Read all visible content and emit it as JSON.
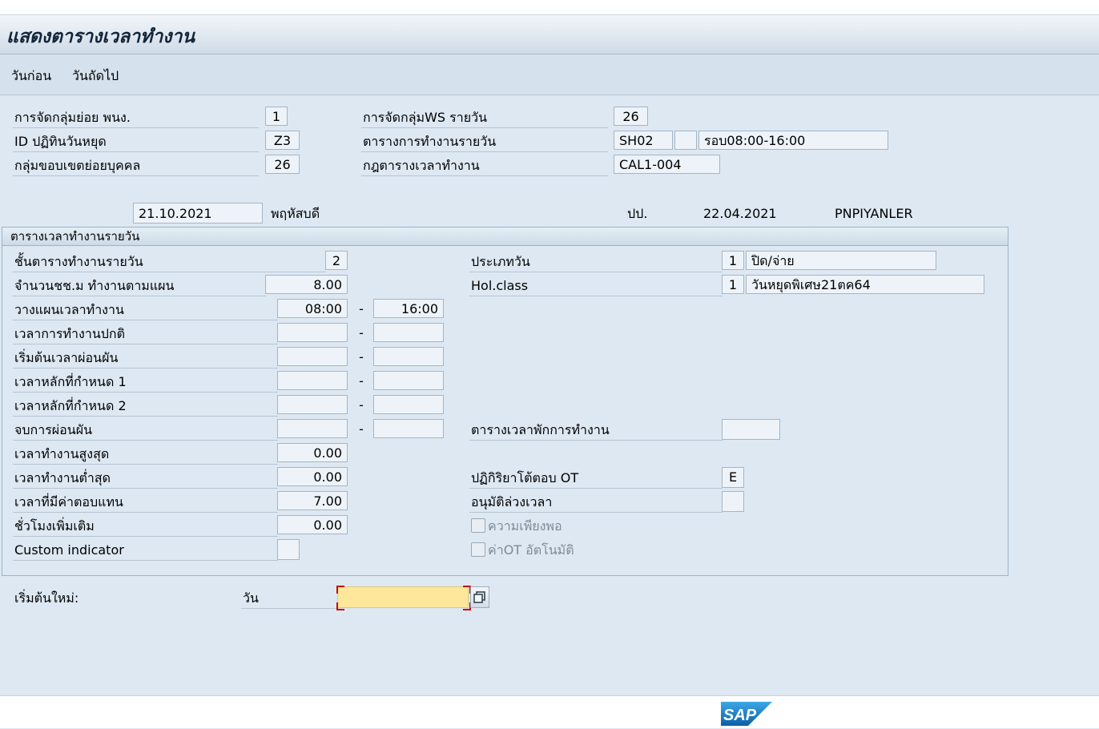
{
  "window": {
    "title": "แสดงตารางเวลาทำงาน"
  },
  "toolbar": {
    "prev_day": "วันก่อน",
    "next_day": "วันถัดไป"
  },
  "header": {
    "ee_subgroup_label": "การจัดกลุ่มย่อย พนง.",
    "ee_subgroup_value": "1",
    "holiday_cal_label": "ID ปฏิทินวันหยุด",
    "holiday_cal_value": "Z3",
    "ps_subarea_label": "กลุ่มขอบเขตย่อยบุคคล",
    "ps_subarea_value": "26",
    "ws_grouping_label": "การจัดกลุ่มWS รายวัน",
    "ws_grouping_value": "26",
    "daily_ws_label": "ตารางการทำงานรายวัน",
    "daily_ws_value": "SH02",
    "daily_ws_variant": "",
    "daily_ws_text": "รอบ08:00-16:00",
    "ws_rule_label": "กฎตารางเวลาทำงาน",
    "ws_rule_value": "CAL1-004"
  },
  "daterow": {
    "date": "21.10.2021",
    "weekday": "พฤหัสบดี",
    "changed_label": "ปป.",
    "changed_date": "22.04.2021",
    "changed_by": "PNPIYANLER"
  },
  "group": {
    "title": "ตารางเวลาทำงานรายวัน",
    "ws_class_label": "ชั้นตารางทำงานรายวัน",
    "ws_class_value": "2",
    "planned_hours_label": "จำนวนชช.ม ทำงานตามแผน",
    "planned_hours_value": "8.00",
    "planned_time_label": "วางแผนเวลาทำงาน",
    "planned_from": "08:00",
    "planned_to": "16:00",
    "normal_time_label": "เวลาการทำงานปกติ",
    "flex_start_label": "เริ่มต้นเวลาผ่อนผัน",
    "core1_label": "เวลาหลักที่กำหนด 1",
    "core2_label": "เวลาหลักที่กำหนด 2",
    "flex_end_label": "จบการผ่อนผัน",
    "max_hours_label": "เวลาทำงานสูงสุด",
    "max_hours_value": "0.00",
    "min_hours_label": "เวลาทำงานต่ำสุด",
    "min_hours_value": "0.00",
    "comp_hours_label": "เวลาที่มีค่าตอบแทน",
    "comp_hours_value": "7.00",
    "add_hours_label": "ชั่วโมงเพิ่มเติม",
    "add_hours_value": "0.00",
    "custom_indicator_label": "Custom indicator",
    "dash": "-",
    "day_type_label": "ประเภทวัน",
    "day_type_value": "1",
    "day_type_text": "ปิด/จ่าย",
    "hol_class_label": "Hol.class",
    "hol_class_value": "1",
    "hol_class_text": "วันหยุดพิเศษ21ตค64",
    "break_schedule_label": "ตารางเวลาพักการทำงาน",
    "ot_reaction_label": "ปฏิกิริยาโต้ตอบ OT",
    "ot_reaction_value": "E",
    "ot_approval_label": "อนุมัติล่วงเวลา",
    "sufficiency_label": "ความเพียงพอ",
    "auto_ot_label": "ค่าOT อัตโนมัติ"
  },
  "new_start": {
    "label": "เริ่มต้นใหม่:",
    "day_label": "วัน",
    "value": ""
  },
  "footer": {
    "logo": "SAP"
  }
}
